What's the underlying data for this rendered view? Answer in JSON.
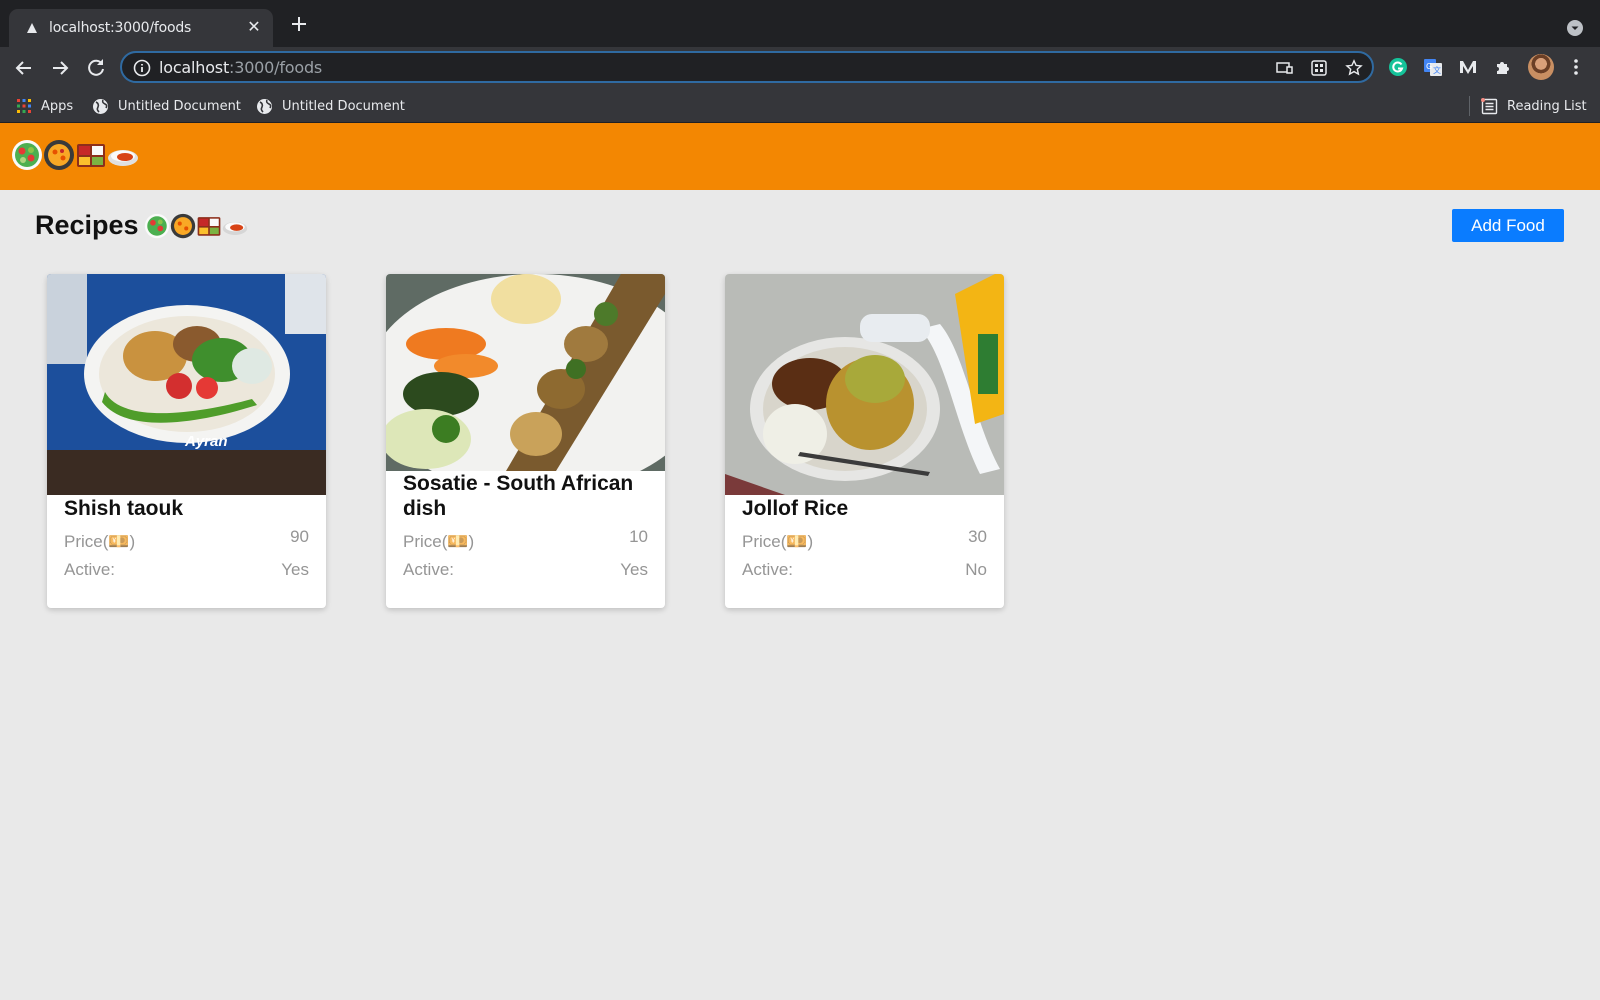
{
  "browser": {
    "tab_title": "localhost:3000/foods",
    "url_host": "localhost",
    "url_path": ":3000/foods",
    "bookmarks": [
      {
        "label": "Apps",
        "icon": "apps-grid-icon"
      },
      {
        "label": "Untitled Document",
        "icon": "globe-icon"
      },
      {
        "label": "Untitled Document",
        "icon": "globe-icon"
      }
    ],
    "reading_list_label": "Reading List",
    "accent_color": "#2f6aa1"
  },
  "app": {
    "header_color": "#f38702",
    "logo_icons": [
      "salad-icon",
      "paella-pan-icon",
      "bento-box-icon",
      "curry-rice-icon"
    ],
    "page_title": "Recipes",
    "add_button_label": "Add Food",
    "add_button_color": "#0a7cff"
  },
  "foods": [
    {
      "name": "Shish taouk",
      "price_label": "Price(💴)",
      "price": "90",
      "active_label": "Active:",
      "active": "Yes"
    },
    {
      "name": "Sosatie - South African dish",
      "price_label": "Price(💴)",
      "price": "10",
      "active_label": "Active:",
      "active": "Yes"
    },
    {
      "name": "Jollof Rice",
      "price_label": "Price(💴)",
      "price": "30",
      "active_label": "Active:",
      "active": "No"
    }
  ]
}
